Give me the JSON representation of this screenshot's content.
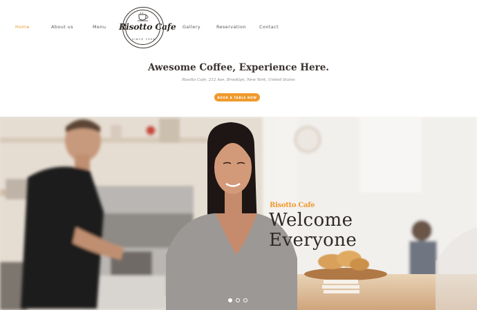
{
  "nav": {
    "items": [
      {
        "label": "Home",
        "active": true
      },
      {
        "label": "About us",
        "active": false
      },
      {
        "label": "Menu",
        "active": false
      },
      {
        "label": "Gallery",
        "active": false
      },
      {
        "label": "Reservation",
        "active": false
      },
      {
        "label": "Contact",
        "active": false
      }
    ]
  },
  "logo": {
    "name": "Risotto Cafe",
    "since": "SINCE 1956",
    "icon": "coffee-cup-icon"
  },
  "intro": {
    "headline": "Awesome Coffee, Experience Here.",
    "address": "Risotto Cafe, 212 Ave, Brooklyn, New York, United States",
    "cta_label": "BOOK A TABLE NOW"
  },
  "hero": {
    "kicker": "Risotto Cafe",
    "title_line1": "Welcome",
    "title_line2": "Everyone",
    "slides_total": 3,
    "active_slide": 1
  },
  "colors": {
    "accent": "#ef9a2d",
    "text_dark": "#3a3330",
    "text_muted": "#8a837e"
  }
}
